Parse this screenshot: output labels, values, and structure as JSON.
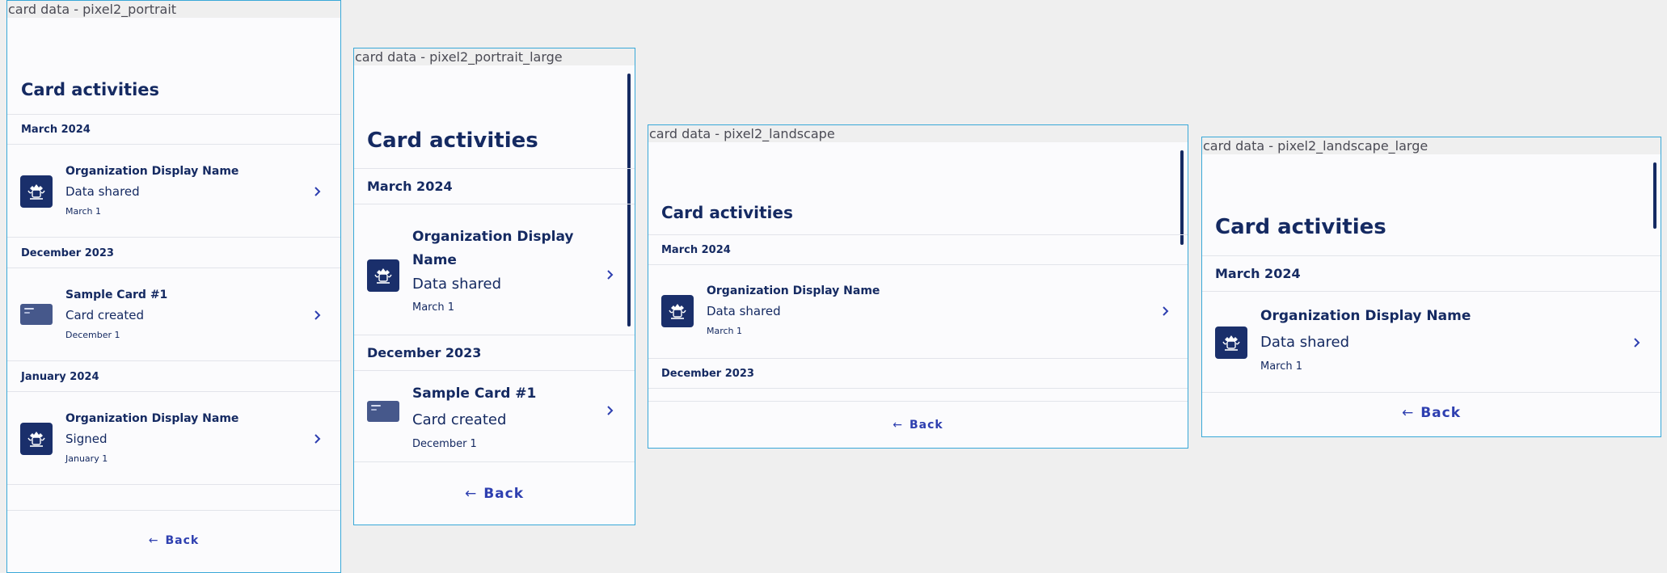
{
  "frames": [
    {
      "label": "card data - pixel2_portrait"
    },
    {
      "label": "card data - pixel2_portrait_large"
    },
    {
      "label": "card data - pixel2_landscape"
    },
    {
      "label": "card data - pixel2_landscape_large"
    }
  ],
  "screen": {
    "title": "Card activities",
    "back_label": "Back",
    "back_icon": "arrow-left-icon",
    "chevron_icon": "chevron-right-icon",
    "sections": [
      {
        "month": "March 2024",
        "items": [
          {
            "title": "Organization Display Name",
            "subtitle": "Data shared",
            "date": "March 1",
            "icon": "organization-crest-icon"
          }
        ]
      },
      {
        "month": "December 2023",
        "items": [
          {
            "title": "Sample Card #1",
            "subtitle": "Card created",
            "date": "December 1",
            "icon": "card-thumbnail-icon"
          }
        ]
      },
      {
        "month": "January 2024",
        "items": [
          {
            "title": "Organization Display Name",
            "subtitle": "Signed",
            "date": "January 1",
            "icon": "organization-crest-icon"
          }
        ]
      }
    ]
  },
  "colors": {
    "text": "#152a62",
    "accent": "#2e3fb0",
    "logo_bg": "#1a2f6b",
    "frame_border": "#39a8d8",
    "background": "#efefef"
  }
}
